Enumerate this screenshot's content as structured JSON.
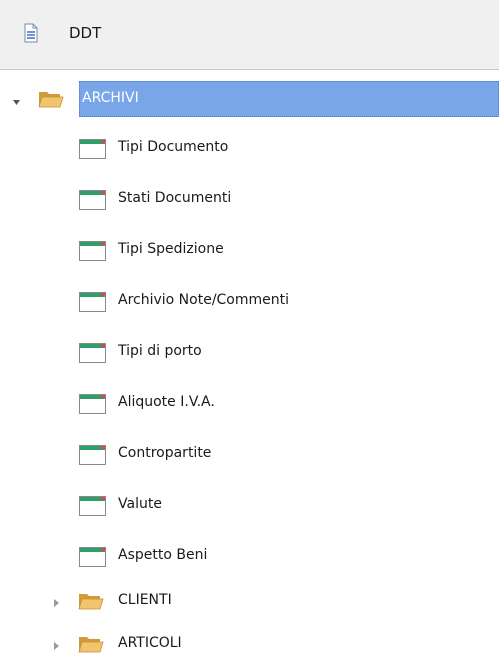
{
  "header": {
    "title": "DDT",
    "icon": "document-icon"
  },
  "tree": {
    "root": {
      "label": "ARCHIVI",
      "expanded": true,
      "selected": true,
      "icon": "folder-open-icon"
    },
    "children": [
      {
        "label": "Tipi Documento"
      },
      {
        "label": "Stati Documenti"
      },
      {
        "label": "Tipi Spedizione"
      },
      {
        "label": "Archivio Note/Commenti"
      },
      {
        "label": "Tipi di porto"
      },
      {
        "label": "Aliquote I.V.A."
      },
      {
        "label": "Contropartite"
      },
      {
        "label": "Valute"
      },
      {
        "label": "Aspetto Beni"
      }
    ],
    "siblings": [
      {
        "label": "CLIENTI",
        "expanded": false
      },
      {
        "label": "ARTICOLI",
        "expanded": false
      }
    ]
  },
  "colors": {
    "selection": "#78a6e8",
    "folder": "#e8b65a",
    "table_header": "#2e9f6b"
  }
}
